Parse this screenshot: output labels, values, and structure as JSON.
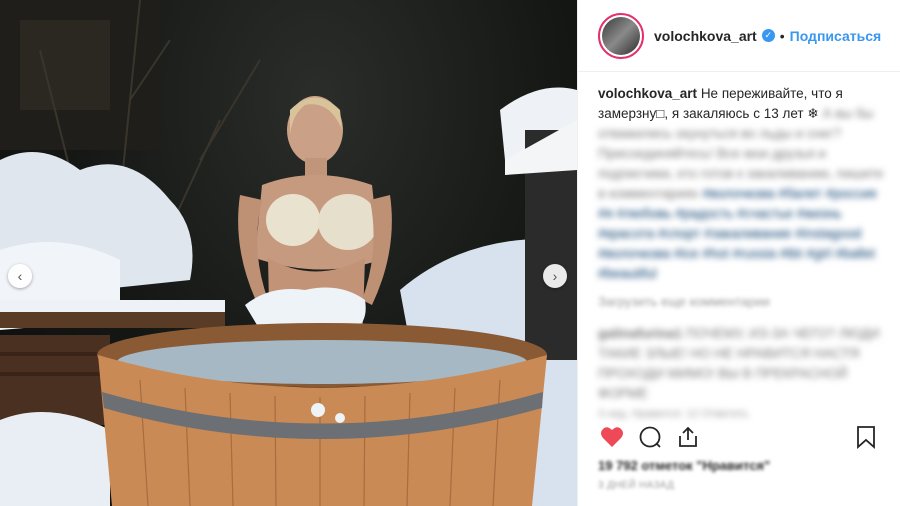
{
  "header": {
    "username": "volochkova_art",
    "follow_label": "Подписаться",
    "dot": "•",
    "verified_glyph": "✓"
  },
  "caption": {
    "username": "volochkova_art",
    "text": "Не переживайте, что я замерзну□, я закаляюсь с 13 лет ❄",
    "blurred_text": "А вы бы отважились окунуться во льды и снег? Присоединяйтесь! Все мои друзья и подписчики, кто готов к закаливанию, пишите в комментариях",
    "hashtags": "#волочкова #балет #россия #я #любовь #радость #счастье #жизнь #красота #спорт #закаливание #instagood #волочкова #ice #hot #russia #tbt #girl #ballet #beautiful"
  },
  "load_more_label": "Загрузить еще комментарии",
  "comment": {
    "username": "galinafurina1",
    "text": "ПОЧЕМУ, ИЗ-ЗА ЧЕГО? ЛЮДИ ТАКИЕ ЗЛЫЕ! НО НЕ НРАВИТСЯ НАСТЯ ПРОХОДИ МИМО! ВЫ В ПРЕКРАСНОЙ ФОРМЕ",
    "meta": "3 нед. Нравится: 12 Ответить"
  },
  "likes_text": "19 792 отметок \"Нравится\"",
  "timestamp": "3 ДНЕЙ НАЗАД",
  "nav": {
    "prev_glyph": "‹",
    "next_glyph": "›"
  },
  "colors": {
    "accent_blue": "#3897f0",
    "like_red": "#ed4956",
    "avatar_ring": "#e1306c"
  },
  "icons": [
    "heart-icon",
    "comment-icon",
    "share-icon",
    "bookmark-icon",
    "chevron-left-icon",
    "chevron-right-icon",
    "verified-icon"
  ]
}
